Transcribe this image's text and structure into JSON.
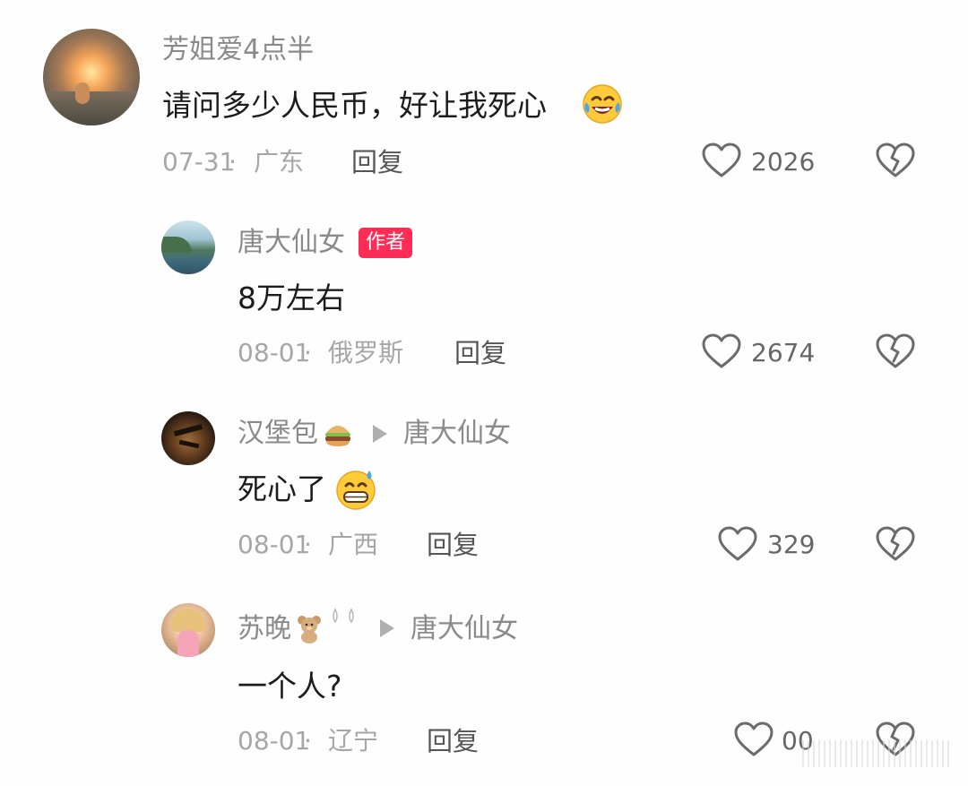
{
  "comments": [
    {
      "username": "芳姐爱4点半",
      "text": "请问多少人民币，好让我死心",
      "date": "07-31",
      "location": "广东",
      "reply_label": "回复",
      "likes": "2026",
      "emoji": "face-with-tears-of-joy"
    },
    {
      "username": "唐大仙女",
      "author_badge": "作者",
      "text": "8万左右",
      "date": "08-01",
      "location": "俄罗斯",
      "reply_label": "回复",
      "likes": "2674"
    },
    {
      "username": "汉堡包",
      "username_emoji": "hamburger",
      "reply_to": "唐大仙女",
      "text": "死心了",
      "emoji": "grinning-face-with-sweat",
      "date": "08-01",
      "location": "广西",
      "reply_label": "回复",
      "likes": "329"
    },
    {
      "username": "苏晚",
      "username_emoji": "teddy-bear",
      "reply_to": "唐大仙女",
      "text": "一个人?",
      "date": "08-01",
      "location": "辽宁",
      "reply_label": "回复",
      "likes": "00"
    }
  ],
  "separator": " · ",
  "colors": {
    "author_badge_bg": "#ff2c55",
    "username": "#8a8a8a",
    "text": "#1c1c1c",
    "meta": "#a6a6a6"
  }
}
